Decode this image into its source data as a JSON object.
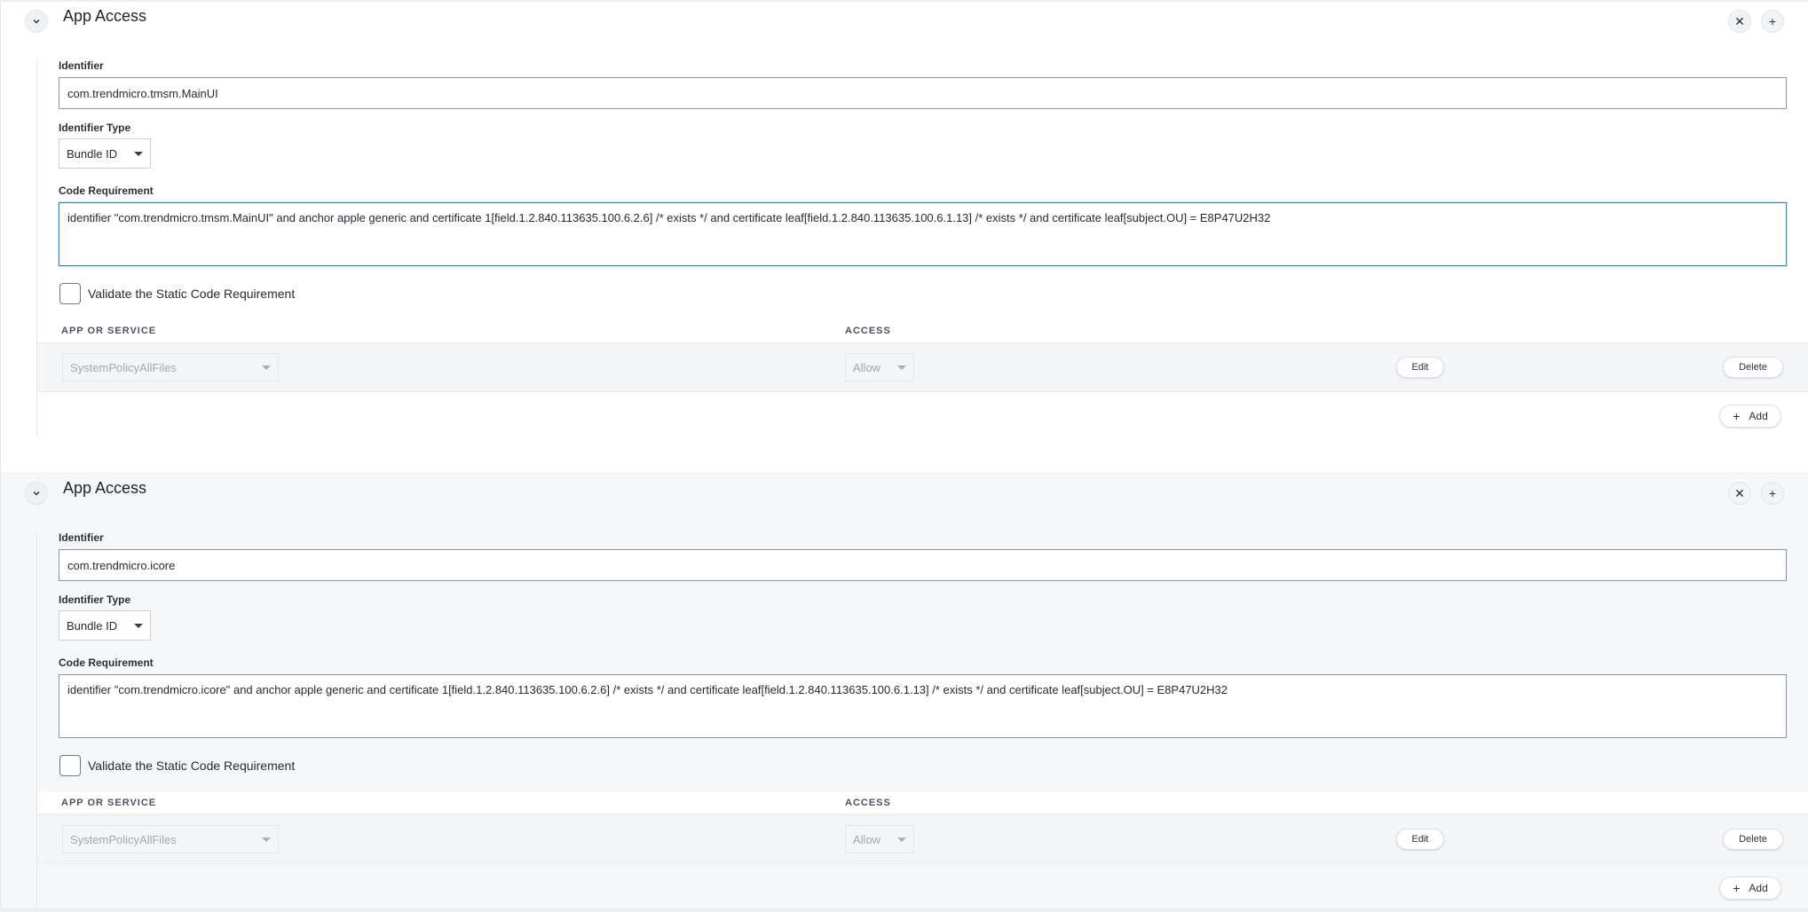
{
  "sections": [
    {
      "title": "App Access",
      "identifier_label": "Identifier",
      "identifier_value": "com.trendmicro.tmsm.MainUI",
      "identifier_type_label": "Identifier Type",
      "identifier_type_value": "Bundle ID",
      "code_requirement_label": "Code Requirement",
      "code_requirement_value": "identifier \"com.trendmicro.tmsm.MainUI\" and anchor apple generic and certificate 1[field.1.2.840.113635.100.6.2.6] /* exists */ and certificate leaf[field.1.2.840.113635.100.6.1.13] /* exists */ and certificate leaf[subject.OU] = E8P47U2H32",
      "validate_label": "Validate the Static Code Requirement",
      "col_app_or_service": "APP OR SERVICE",
      "col_access": "ACCESS",
      "row": {
        "service": "SystemPolicyAllFiles",
        "access": "Allow",
        "edit_label": "Edit",
        "delete_label": "Delete"
      },
      "add_label": "Add"
    },
    {
      "title": "App Access",
      "identifier_label": "Identifier",
      "identifier_value": "com.trendmicro.icore",
      "identifier_type_label": "Identifier Type",
      "identifier_type_value": "Bundle ID",
      "code_requirement_label": "Code Requirement",
      "code_requirement_value": "identifier \"com.trendmicro.icore\" and anchor apple generic and certificate 1[field.1.2.840.113635.100.6.2.6] /* exists */ and certificate leaf[field.1.2.840.113635.100.6.1.13] /* exists */ and certificate leaf[subject.OU] = E8P47U2H32",
      "validate_label": "Validate the Static Code Requirement",
      "col_app_or_service": "APP OR SERVICE",
      "col_access": "ACCESS",
      "row": {
        "service": "SystemPolicyAllFiles",
        "access": "Allow",
        "edit_label": "Edit",
        "delete_label": "Delete"
      },
      "add_label": "Add"
    }
  ],
  "icons": {
    "collapse": "chevron-down-icon",
    "remove": "close-icon",
    "add": "plus-icon",
    "dropdown": "caret-down-icon"
  },
  "colors": {
    "focus_border": "#3f7fa8",
    "section_alt_bg": "#f6f7f9",
    "row_bg": "#f4f5f7"
  }
}
